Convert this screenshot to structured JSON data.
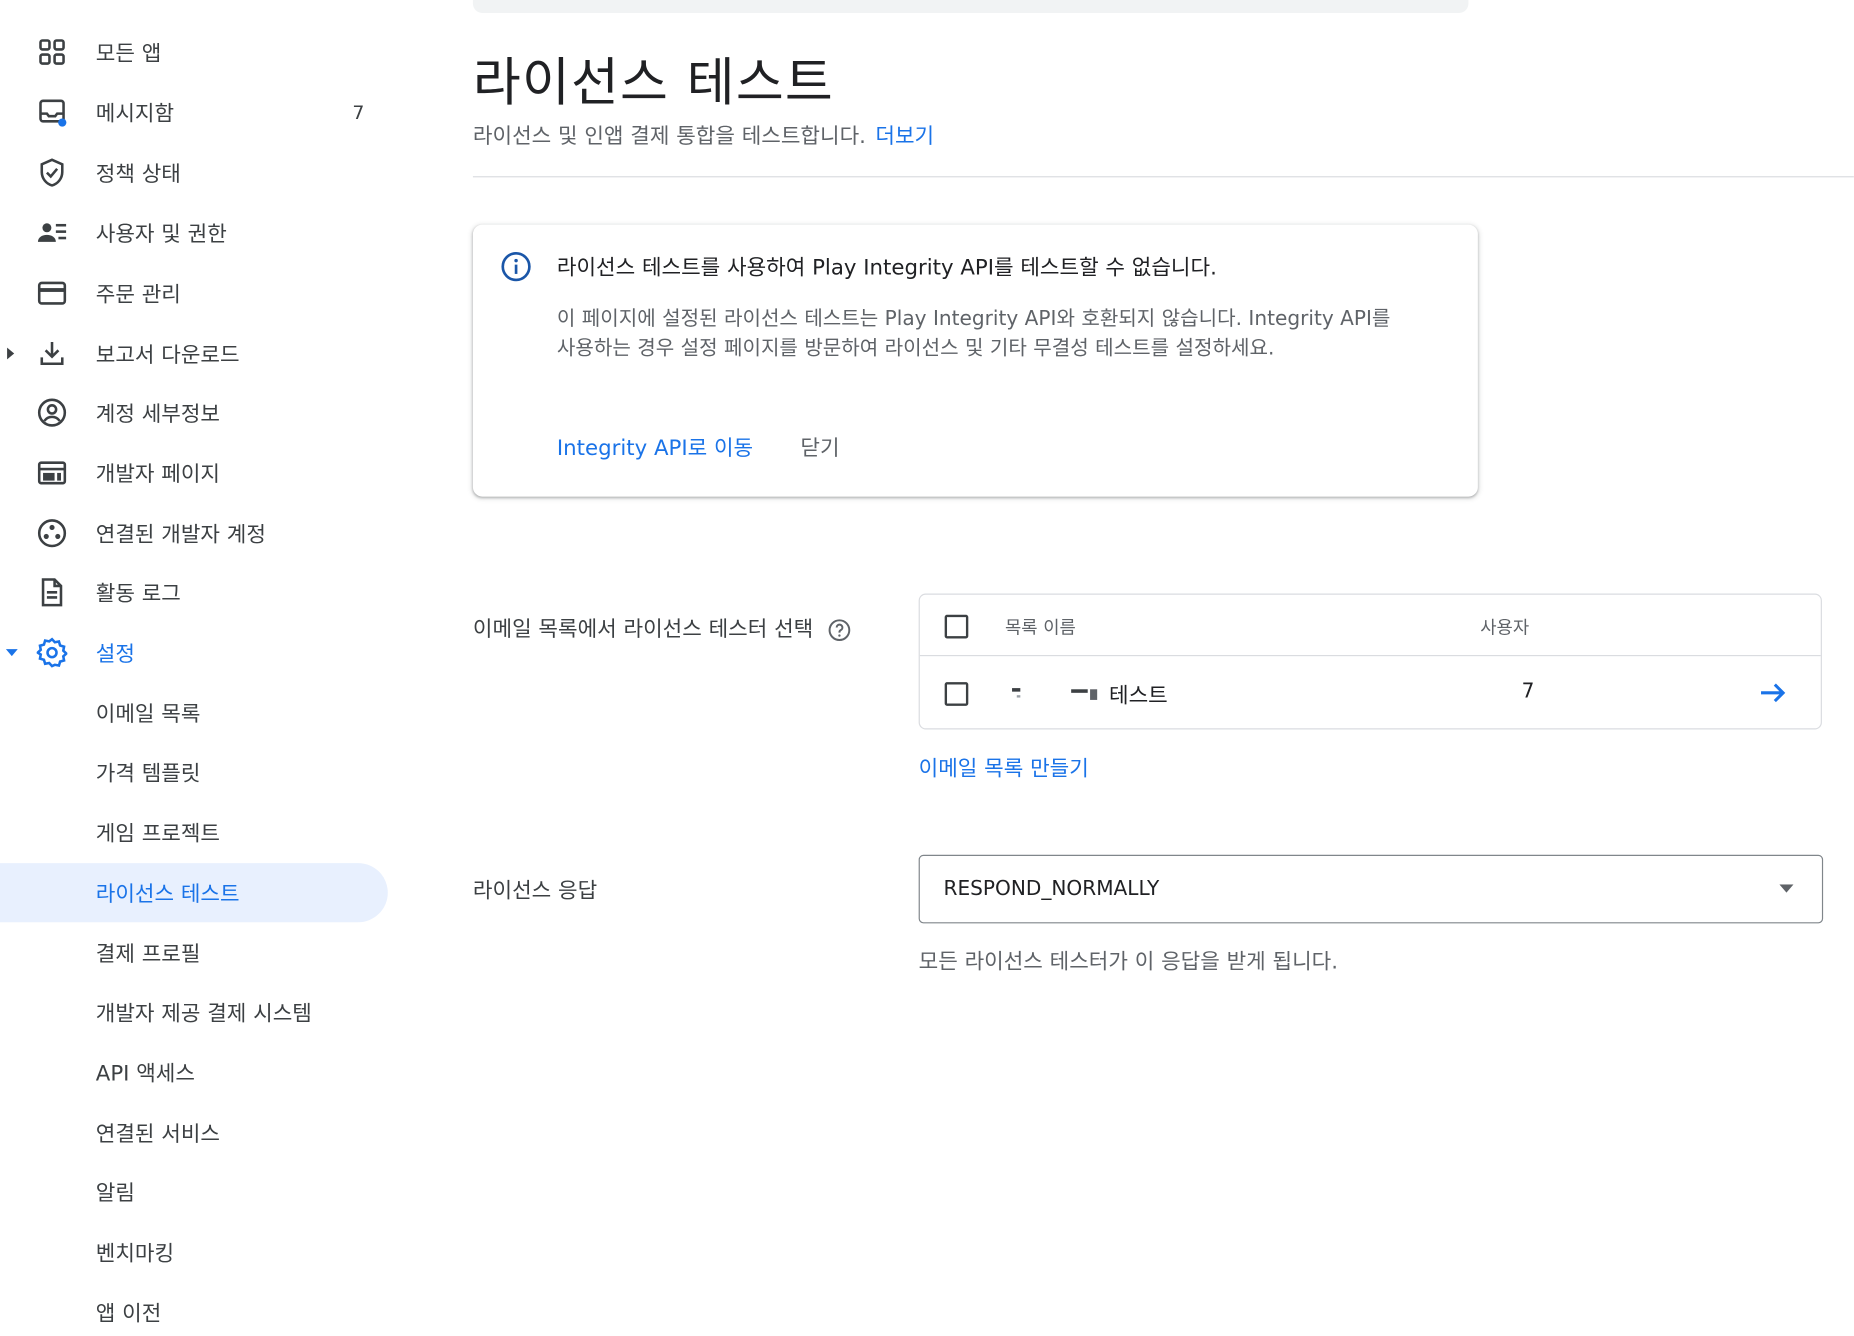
{
  "sidebar": {
    "items": [
      {
        "label": "모든 앱",
        "icon": "grid-icon"
      },
      {
        "label": "메시지함",
        "icon": "inbox-icon",
        "count": "7"
      },
      {
        "label": "정책 상태",
        "icon": "shield-check-icon"
      },
      {
        "label": "사용자 및 권한",
        "icon": "people-list-icon"
      },
      {
        "label": "주문 관리",
        "icon": "credit-card-icon"
      },
      {
        "label": "보고서 다운로드",
        "icon": "download-icon"
      },
      {
        "label": "계정 세부정보",
        "icon": "account-circle-icon"
      },
      {
        "label": "개발자 페이지",
        "icon": "web-page-icon"
      },
      {
        "label": "연결된 개발자 계정",
        "icon": "linked-accounts-icon"
      },
      {
        "label": "활동 로그",
        "icon": "document-icon"
      },
      {
        "label": "설정",
        "icon": "gear-icon"
      }
    ],
    "sub_items": [
      {
        "label": "이메일 목록"
      },
      {
        "label": "가격 템플릿"
      },
      {
        "label": "게임 프로젝트"
      },
      {
        "label": "라이선스 테스트"
      },
      {
        "label": "결제 프로필"
      },
      {
        "label": "개발자 제공 결제 시스템"
      },
      {
        "label": "API 액세스"
      },
      {
        "label": "연결된 서비스"
      },
      {
        "label": "알림"
      },
      {
        "label": "벤치마킹"
      },
      {
        "label": "앱 이전"
      }
    ]
  },
  "main": {
    "title": "라이선스 테스트",
    "subtitle": "라이선스 및 인앱 결제 통합을 테스트합니다.",
    "more_link": "더보기",
    "info_card": {
      "title": "라이선스 테스트를 사용하여 Play Integrity API를 테스트할 수 없습니다.",
      "body": "이 페이지에 설정된 라이선스 테스트는 Play Integrity API와 호환되지 않습니다. Integrity API를 사용하는 경우 설정 페이지를 방문하여 라이선스 및 기타 무결성 테스트를 설정하세요.",
      "action_link": "Integrity API로 이동",
      "close_label": "닫기"
    },
    "email_section": {
      "label": "이메일 목록에서 라이선스 테스터 선택",
      "columns": {
        "name": "목록 이름",
        "users": "사용자"
      },
      "rows": [
        {
          "name": "테스트",
          "users": "7"
        }
      ],
      "create_link": "이메일 목록 만들기"
    },
    "response_section": {
      "label": "라이선스 응답",
      "selected_value": "RESPOND_NORMALLY",
      "helper": "모든 라이선스 테스터가 이 응답을 받게 됩니다."
    }
  },
  "colors": {
    "accent": "#1a73e8",
    "selected_bg": "#e8f0fe",
    "text_primary": "#202124",
    "text_secondary": "#5f6368"
  }
}
